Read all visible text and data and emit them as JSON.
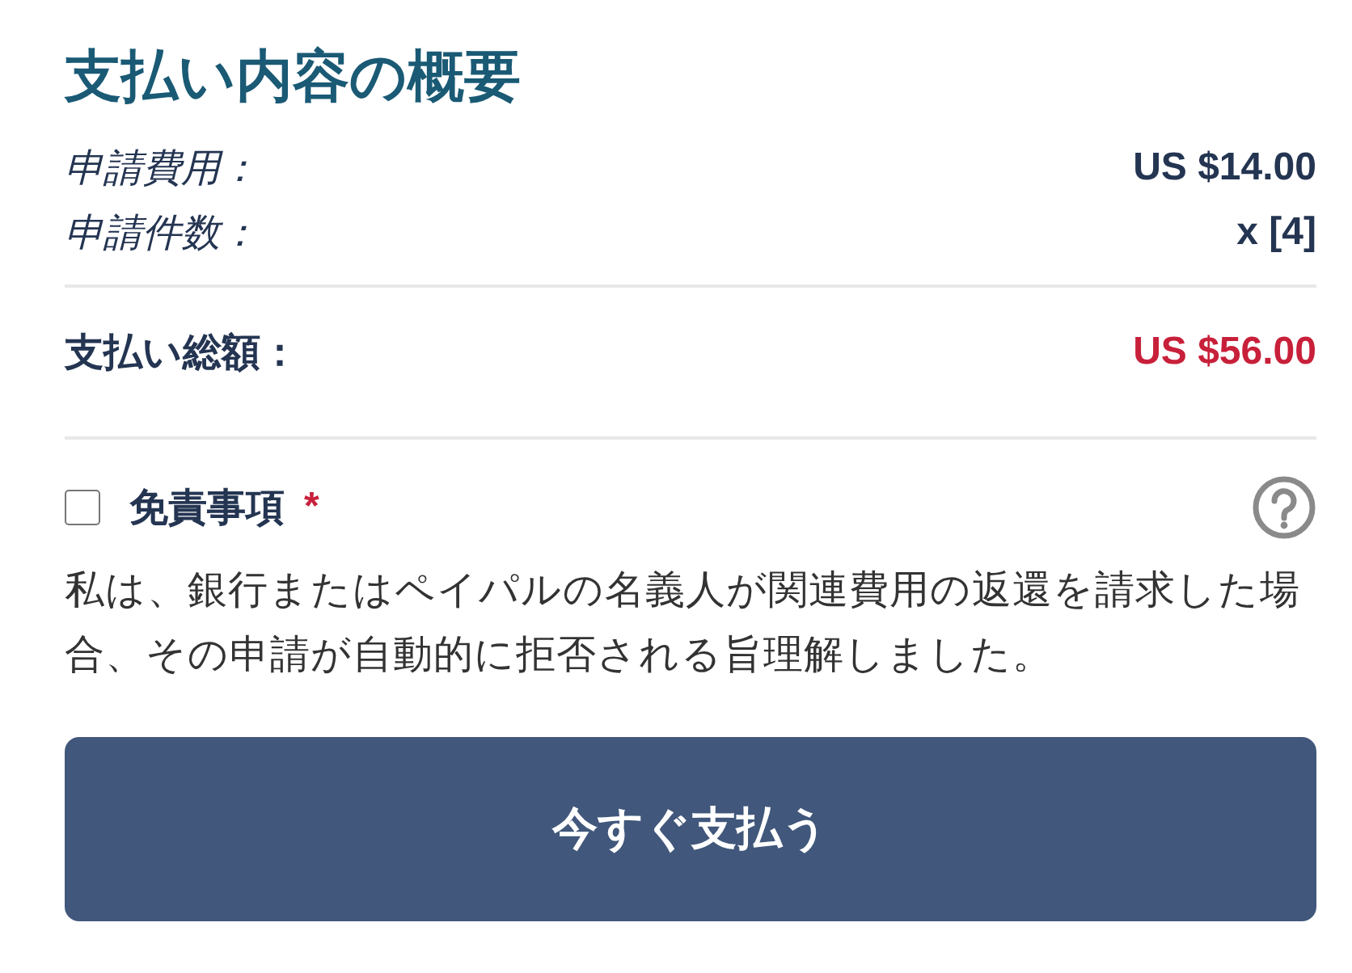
{
  "title": "支払い内容の概要",
  "items": [
    {
      "label": "申請費用：",
      "value": "US $14.00"
    },
    {
      "label": "申請件数：",
      "value": "x [4]"
    }
  ],
  "total": {
    "label": "支払い総額：",
    "value": "US $56.00"
  },
  "disclaimer": {
    "label": "免責事項",
    "required_mark": "*",
    "checked": false,
    "text": "私は、銀行またはペイパルの名義人が関連費用の返還を請求した場合、その申請が自動的に拒否される旨理解しました。"
  },
  "pay_button": "今すぐ支払う"
}
